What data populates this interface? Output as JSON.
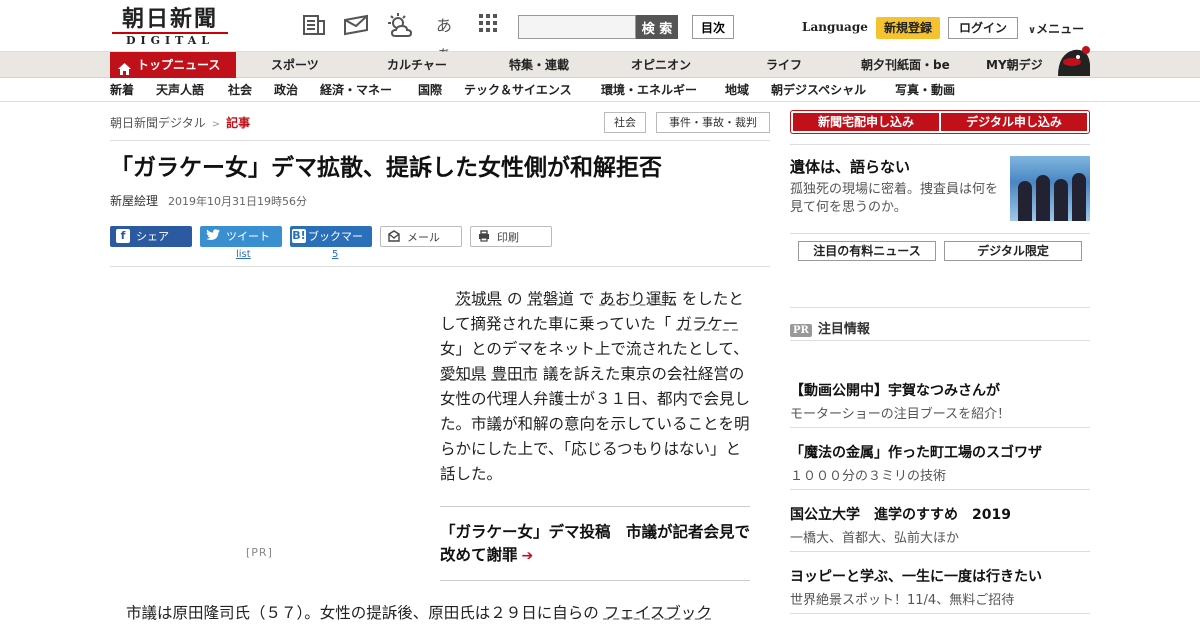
{
  "header": {
    "logo_main": "朝日新聞",
    "logo_sub": "DIGITAL",
    "icons": [
      "newspaper-icon",
      "mail-icon",
      "weather-icon",
      "font-size-icon",
      "grid-icon"
    ],
    "font_size_label": "あぁ",
    "search_placeholder": "",
    "search_button": "検 索",
    "toc_button": "目次",
    "language": "Language",
    "signup": "新規登録",
    "login": "ログイン",
    "menu": "メニュー"
  },
  "nav_primary": {
    "top_news": "トップニュース",
    "items": [
      "スポーツ",
      "カルチャー",
      "特集・連載",
      "オピニオン",
      "ライフ",
      "朝夕刊紙面・be",
      "MY朝デジ"
    ]
  },
  "nav_secondary": {
    "items": [
      "新着",
      "天声人語",
      "社会",
      "政治",
      "経済・マネー",
      "国際",
      "テック＆サイエンス",
      "環境・エネルギー",
      "地域",
      "朝デジスペシャル",
      "写真・動画"
    ]
  },
  "breadcrumb": {
    "home": "朝日新聞デジタル",
    "separator": ">",
    "current": "記事"
  },
  "tags": [
    "社会",
    "事件・事故・裁判"
  ],
  "article": {
    "headline": "「ガラケー女」デマ拡散、提訴した女性側が和解拒否",
    "author": "新屋絵理",
    "date": "2019年10月31日19時56分",
    "share": {
      "facebook": "シェア",
      "twitter": "ツイート",
      "twitter_count": "list",
      "hatena": "ブックマーク",
      "hatena_count": "5",
      "mail": "メール",
      "print": "印刷"
    },
    "pr_label": "[PR]",
    "body": {
      "l1_indent": "　",
      "link_ibaraki": "茨城県",
      "t1": " の ",
      "link_joban": "常磐道",
      "t2": " で ",
      "link_aori": "あおり運転",
      "t3": " をしたとして摘発された車に乗っていた「 ",
      "link_garake": "ガラケー",
      "t4": " 女」とのデマをネット上で流されたとして、 ",
      "link_aichi": "愛知県",
      "t5": " ",
      "link_toyota": "豊田市",
      "t6": " 議を訴えた東京の会社経営の女性の代理人弁護士が３１日、都内で会見した。市議が和解の意向を示していることを明らかにした上で、「応じるつもりはない」と話した。"
    },
    "related": "「ガラケー女」デマ投稿　市議が記者会見で改めて謝罪",
    "related_arrow": "➔",
    "para2_text": "市議は原田隆司氏（５７）。女性の提訴後、原田氏は２９日に自らの ",
    "para2_link": "フェイスブック"
  },
  "sidebar": {
    "subscribe_paper": "新聞宅配申し込み",
    "subscribe_digital": "デジタル申し込み",
    "feature_title": "遺体は、語らない",
    "feature_desc": "孤独死の現場に密着。捜査員は何を見て何を思うのか。",
    "btn_paid_news": "注目の有料ニュース",
    "btn_digital_only": "デジタル限定",
    "pr_badge": "PR",
    "pr_heading": "注目情報",
    "ads": [
      {
        "title": "【動画公開中】宇賀なつみさんが",
        "desc": "モーターショーの注目ブースを紹介！"
      },
      {
        "title": "「魔法の金属」作った町工場のスゴワザ",
        "desc": "１０００分の３ミリの技術"
      },
      {
        "title": "国公立大学　進学のすすめ　2019",
        "desc": "一橋大、首都大、弘前大ほか"
      },
      {
        "title": "ヨッピーと学ぶ、一生に一度は行きたい",
        "desc": "世界絶景スポット！11/4、無料ご招待"
      }
    ]
  },
  "colors": {
    "brand_red": "#c0111b",
    "signup_yellow": "#f5c330",
    "nav_bg": "#eae7e2"
  }
}
